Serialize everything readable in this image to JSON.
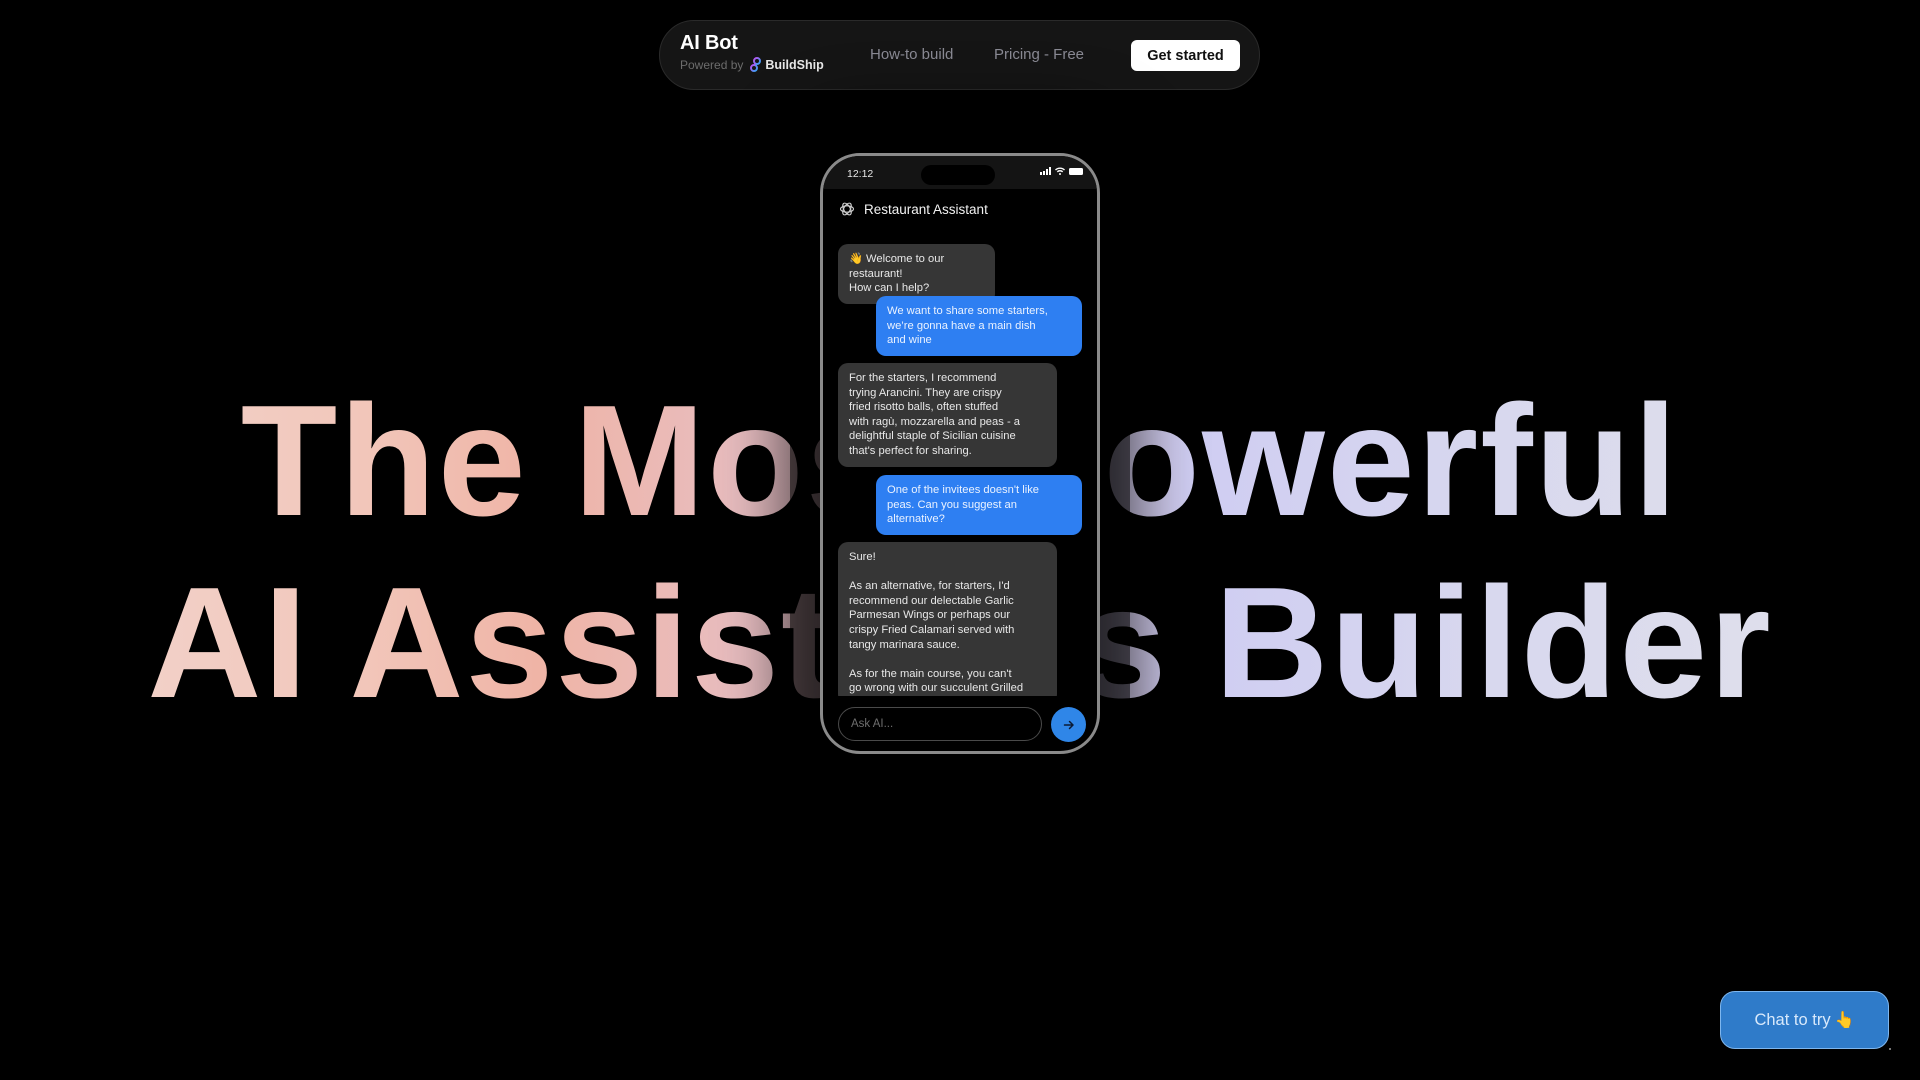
{
  "nav": {
    "brand_title": "AI Bot",
    "powered_by": "Powered by",
    "powered_brand": "BuildShip",
    "links": [
      "How-to build",
      "Pricing - Free"
    ],
    "cta": "Get started"
  },
  "hero": {
    "line1": "The Most Powerful",
    "line2": "AI Assistants Builder"
  },
  "phone": {
    "time": "12:12",
    "chat_title": "Restaurant Assistant",
    "messages": [
      {
        "role": "bot",
        "text": "👋 Welcome to our restaurant!\nHow can I help?"
      },
      {
        "role": "user",
        "text": "We want to share some starters,\nwe’re gonna have a main dish\nand wine"
      },
      {
        "role": "bot",
        "text": "For the starters, I recommend\ntrying Arancini. They are crispy\nfried risotto balls, often stuffed\nwith ragù, mozzarella and peas - a\ndelightful staple of Sicilian cuisine\nthat's perfect for sharing."
      },
      {
        "role": "user",
        "text": "One of the invitees doesn't like\npeas. Can you suggest an\nalternative?"
      },
      {
        "role": "bot",
        "text": "Sure!\n\nAs an alternative, for starters, I'd\nrecommend our delectable Garlic\nParmesan Wings or perhaps our\ncrispy Fried Calamari served with\ntangy marinara sauce.\n\nAs for the main course, you can't\ngo wrong with our succulent Grilled"
      }
    ],
    "input_placeholder": "Ask AI...",
    "input_value": ""
  },
  "chat_try": {
    "label": "Chat to try",
    "emoji": "👆"
  },
  "colors": {
    "background": "#000000",
    "user_bubble": "#2e7ff2",
    "bot_bubble": "#363636",
    "send_button": "#2f86e8",
    "chat_try_button": "#2f7bc9"
  }
}
